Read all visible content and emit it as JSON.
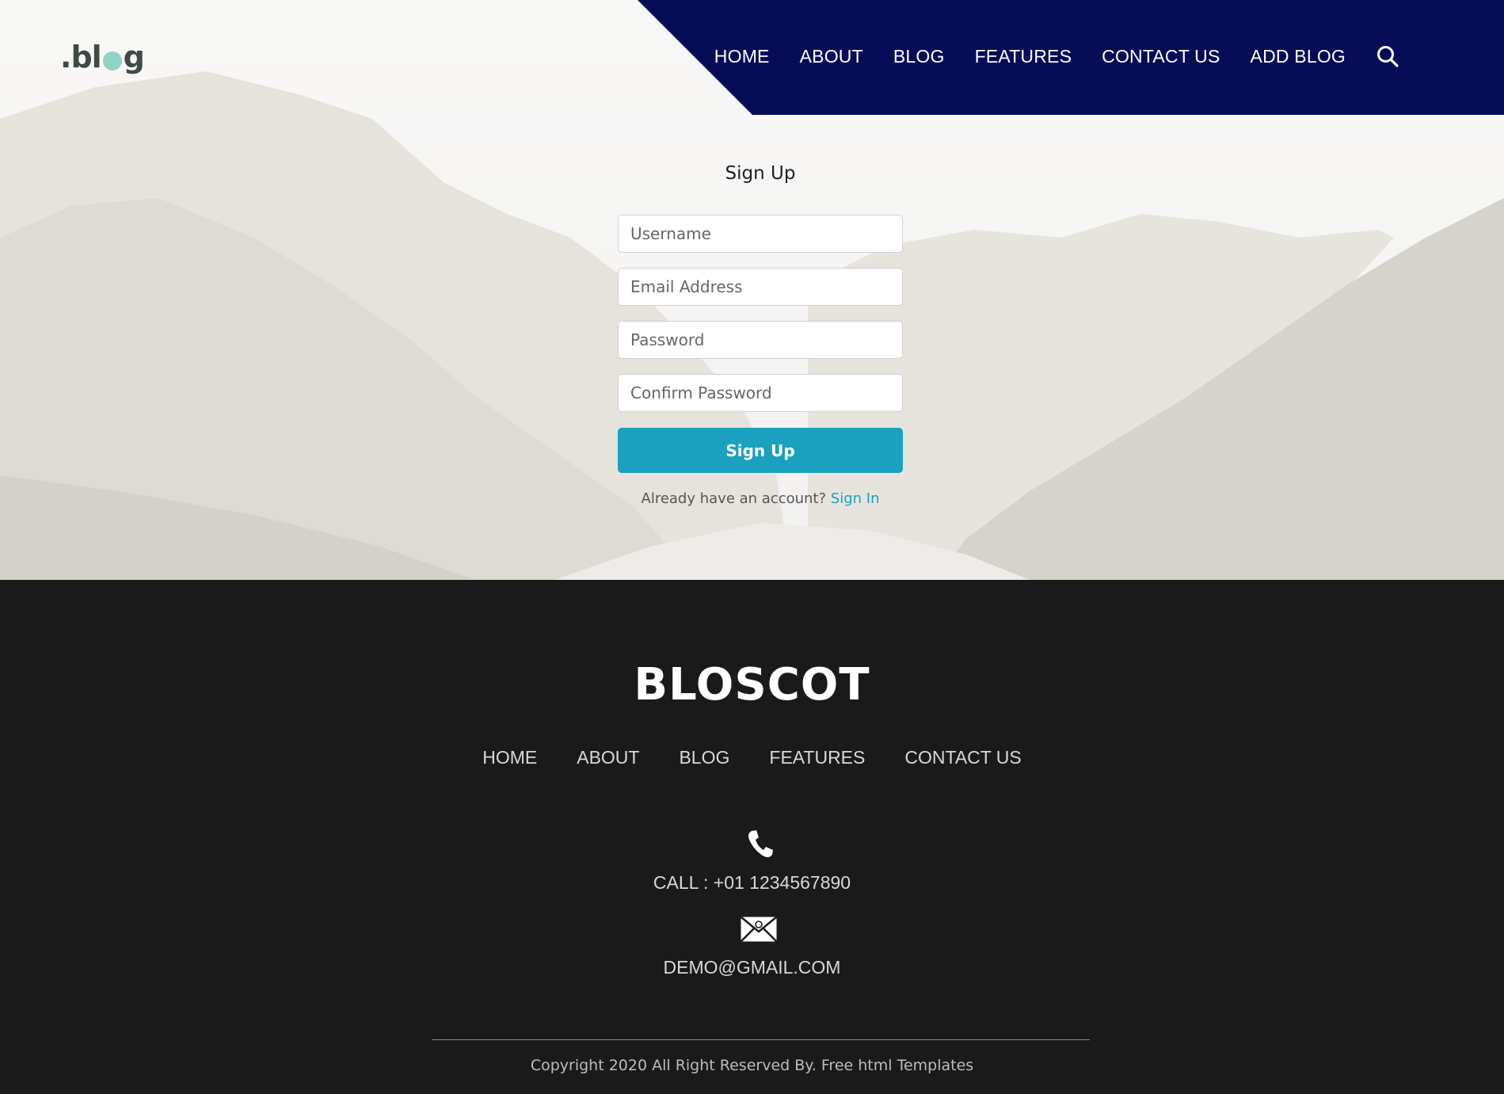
{
  "header": {
    "logo": {
      "dot": ".",
      "part1": "bl",
      "part2": "g"
    },
    "nav": [
      "HOME",
      "ABOUT",
      "BLOG",
      "FEATURES",
      "CONTACT US",
      "ADD BLOG"
    ],
    "search_icon": "search-icon"
  },
  "form": {
    "title": "Sign Up",
    "username_placeholder": "Username",
    "email_placeholder": "Email Address",
    "password_placeholder": "Password",
    "confirm_placeholder": "Confirm Password",
    "submit_label": "Sign Up",
    "alt_text": "Already have an account?",
    "alt_link": "Sign In"
  },
  "footer": {
    "brand": "BLOSCOT",
    "nav": [
      "HOME",
      "ABOUT",
      "BLOG",
      "FEATURES",
      "CONTACT US"
    ],
    "phone_icon": "phone-icon",
    "call": "CALL : +01 1234567890",
    "mail_icon": "mail-icon",
    "email": "DEMO@GMAIL.COM",
    "copyright": "Copyright 2020 All Right Reserved By. Free html Templates"
  },
  "colors": {
    "nav_bg": "#070c57",
    "accent": "#1aa1bf",
    "footer_bg": "#1a1a1a",
    "logo_o": "#8fd3c4"
  }
}
